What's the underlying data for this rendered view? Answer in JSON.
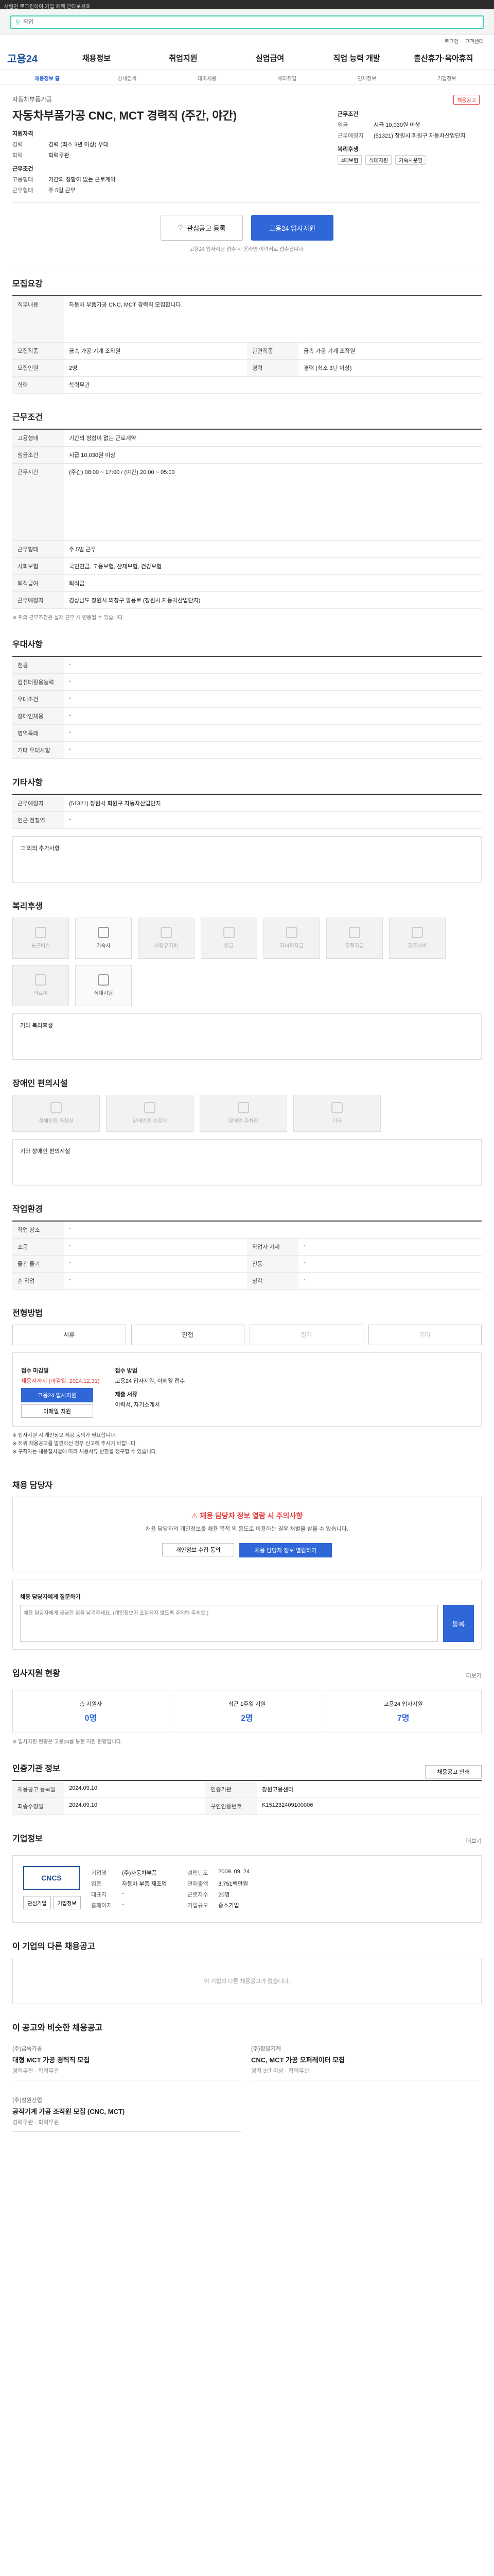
{
  "topbar": {
    "notice": "사람인 로그인하여 가입 혜택 받아보세요"
  },
  "search": {
    "value": "",
    "placeholder": "직업"
  },
  "util": {
    "login": "로그인",
    "help": "고객센터"
  },
  "gnb": {
    "logo": "고용24",
    "menus": [
      "채용정보",
      "취업지원",
      "실업급여",
      "직업 능력 개발",
      "출산휴가·육아휴직"
    ]
  },
  "subnav": [
    "채용정보 홈",
    "상세검색",
    "테마채용",
    "해외취업",
    "인재정보",
    "기업정보"
  ],
  "job": {
    "company": "자동차부품가공",
    "title": "자동차부품가공 CNC, MCT 경력직 (주간, 야간)",
    "badge": "채용공고",
    "left": {
      "section1": "지원자격",
      "rows": [
        {
          "k": "경력",
          "v": "경력 (최소 3년 이상) 우대"
        },
        {
          "k": "학력",
          "v": "학력무관"
        }
      ],
      "section2": "근무조건",
      "rows2": [
        {
          "k": "고용형태",
          "v": "기간의 정함이 없는 근로계약"
        },
        {
          "k": "근무형태",
          "v": "주 5일 근무"
        }
      ]
    },
    "right": {
      "section": "근무조건",
      "rows": [
        {
          "k": "임금",
          "v": "시급 10,030원 이상"
        },
        {
          "k": "근무예정지",
          "v": "(51321) 창원시 회원구 자동차산업단지"
        }
      ],
      "section2": "복리후생",
      "tags": [
        "4대보험",
        "식대지원",
        "기숙사운영"
      ]
    }
  },
  "actions": {
    "scrap": "관심공고 등록",
    "apply": "고용24 입사지원",
    "note": "고용24 입사지원 접수 시 온라인 이력서로 접수됩니다."
  },
  "recruit": {
    "title": "모집요강",
    "job_desc_label": "직무내용",
    "job_desc": "자동차 부품가공 CNC, MCT 경력직 모집합니다.",
    "rows": [
      {
        "k": "모집직종",
        "v": "금속 가공 기계 조작원",
        "k2": "관련직종",
        "v2": "금속 가공 기계 조작원"
      },
      {
        "k": "모집인원",
        "v": "2명",
        "k2": "경력",
        "v2": "경력 (최소 3년 이상)"
      },
      {
        "k": "학력",
        "v": "학력무관",
        "k2": "",
        "v2": ""
      }
    ]
  },
  "work": {
    "title": "근무조건",
    "rows": [
      {
        "k": "고용형태",
        "v": "기간의 정함이 없는 근로계약"
      },
      {
        "k": "임금조건",
        "v": "시급 10,030원 이상"
      },
      {
        "k": "근무시간",
        "v": "(주간) 08:00 ~ 17:00 / (야간) 20:00 ~ 05:00"
      },
      {
        "k": "근무형태",
        "v": "주 5일 근무"
      },
      {
        "k": "사회보험",
        "v": "국민연금, 고용보험, 산재보험, 건강보험"
      },
      {
        "k": "퇴직급여",
        "v": "퇴직금"
      },
      {
        "k": "근무예정지",
        "v": "경상남도 창원시 의창구 팔용로 (창원시 자동차산업단지)"
      }
    ],
    "note": "※ 위의 근무조건은 실제 근무 시 변동될 수 있습니다."
  },
  "pref": {
    "title": "우대사항",
    "rows": [
      {
        "k": "전공",
        "v": "-"
      },
      {
        "k": "컴퓨터활용능력",
        "v": "-"
      },
      {
        "k": "우대조건",
        "v": "-"
      },
      {
        "k": "장애인채용",
        "v": "-"
      },
      {
        "k": "병역특례",
        "v": "-"
      },
      {
        "k": "기타 우대사항",
        "v": "-"
      }
    ]
  },
  "etc": {
    "title": "기타사항",
    "rows": [
      {
        "k": "근무예정지",
        "v": "(51321) 창원시 회원구 자동차산업단지"
      },
      {
        "k": "인근 전철역",
        "v": "-"
      }
    ],
    "free_label": "그 외의 추가사항"
  },
  "welfare": {
    "title": "복리후생",
    "items": [
      {
        "label": "통근버스",
        "on": false,
        "icon": "bus-icon"
      },
      {
        "label": "기숙사",
        "on": true,
        "icon": "bed-icon"
      },
      {
        "label": "차량유지비",
        "on": false,
        "icon": "car-icon"
      },
      {
        "label": "연금",
        "on": false,
        "icon": "pension-icon"
      },
      {
        "label": "자녀학자금",
        "on": false,
        "icon": "graduation-icon"
      },
      {
        "label": "주택자금",
        "on": false,
        "icon": "house-icon"
      },
      {
        "label": "경조사비",
        "on": false,
        "icon": "gift-icon"
      },
      {
        "label": "의료비",
        "on": false,
        "icon": "medical-icon"
      },
      {
        "label": "식대지원",
        "on": true,
        "icon": "meal-icon"
      }
    ],
    "other_label": "기타 복리후생"
  },
  "disability": {
    "title": "장애인 편의시설",
    "items": [
      {
        "label": "장애인용 화장실",
        "icon": "toilet-icon"
      },
      {
        "label": "장애인용 승강기",
        "icon": "elevator-icon"
      },
      {
        "label": "장애인 주차장",
        "icon": "parking-icon"
      },
      {
        "label": "기타",
        "icon": "etc-icon"
      }
    ],
    "other_label": "기타 장애인 편의시설"
  },
  "envt": {
    "title": "작업환경",
    "rows": [
      {
        "k": "작업 장소",
        "v": "-",
        "k2": "",
        "v2": ""
      },
      {
        "k": "소음",
        "v": "-",
        "k2": "작업자 자세",
        "v2": "-"
      },
      {
        "k": "물건 들기",
        "v": "-",
        "k2": "진동",
        "v2": "-"
      },
      {
        "k": "손 작업",
        "v": "-",
        "k2": "청각",
        "v2": "-"
      }
    ]
  },
  "apply": {
    "title": "전형방법",
    "methods": [
      {
        "label": "서류",
        "on": true
      },
      {
        "label": "면접",
        "on": true
      },
      {
        "label": "필기",
        "on": false
      },
      {
        "label": "기타",
        "on": false
      }
    ],
    "period_label": "접수 마감일",
    "period": "채용시까지 (마감일: 2024.12.31)",
    "method_label": "접수 방법",
    "method": "고용24 입사지원, 이메일 접수",
    "docs_label": "제출 서류",
    "docs": "이력서, 자기소개서",
    "btn_apply": "고용24 입사지원",
    "btn_email": "이메일 지원",
    "bullets": [
      "※ 입사지원 시 개인정보 제공 동의가 필요합니다.",
      "※ 허위 채용공고를 발견하신 경우 신고해 주시기 바랍니다.",
      "※ 구직자는 채용절차법에 따라 채용서류 반환을 청구할 수 있습니다."
    ]
  },
  "contact": {
    "title": "채용 담당자",
    "warn_title": "채용 담당자 정보 열람 시 주의사항",
    "warn_desc": "채용 담당자의 개인정보를 채용 목적 외 용도로 이용하는 경우 처벌을 받을 수 있습니다.",
    "btn_personal": "개인정보 수집 동의",
    "btn_view": "채용 담당자 정보 열람하기",
    "q_title": "채용 담당자에게 질문하기",
    "q_placeholder": "채용 담당자에게 궁금한 점을 남겨주세요. (개인정보가 포함되지 않도록 주의해 주세요.)",
    "q_btn": "등록"
  },
  "status": {
    "title": "입사지원 현황",
    "more": "더보기",
    "items": [
      {
        "label": "총 지원자",
        "value": "0명"
      },
      {
        "label": "최근 1주일 지원",
        "value": "2명"
      },
      {
        "label": "고용24 입사지원",
        "value": "7명"
      }
    ],
    "note": "※ 입사지원 현황은 고용24를 통한 지원 현황입니다."
  },
  "reginfo": {
    "title": "인증기관 정보",
    "rows": [
      {
        "k": "채용공고 등록일",
        "v": "2024.09.10",
        "k2": "인증기관",
        "v2": "창원고용센터"
      },
      {
        "k": "최종수정일",
        "v": "2024.09.10",
        "k2": "구인인증번호",
        "v2": "K151232409100006"
      }
    ],
    "btn_print": "채용공고 인쇄"
  },
  "company": {
    "title": "기업정보",
    "more": "더보기",
    "logo": "CNCS",
    "col1": [
      {
        "k": "기업명",
        "v": "(주)자동차부품"
      },
      {
        "k": "업종",
        "v": "자동차 부품 제조업"
      },
      {
        "k": "대표자",
        "v": "-"
      },
      {
        "k": "홈페이지",
        "v": "-"
      }
    ],
    "col2": [
      {
        "k": "설립년도",
        "v": "2009. 09. 24"
      },
      {
        "k": "연매출액",
        "v": "3,751백만원"
      },
      {
        "k": "근로자수",
        "v": "20명"
      },
      {
        "k": "기업규모",
        "v": "중소기업"
      }
    ],
    "btns": [
      "관심기업",
      "기업정보"
    ]
  },
  "other_jobs": {
    "title": "이 기업의 다른 채용공고",
    "empty": "이 기업의 다른 채용공고가 없습니다."
  },
  "recommend": {
    "title": "이 공고와 비슷한 채용공고",
    "cards": [
      {
        "company": "(주)금속가공",
        "title": "대형 MCT 가공 경력직 모집",
        "meta": "경력무관 · 학력무관"
      },
      {
        "company": "(주)정밀기계",
        "title": "CNC, MCT 가공 오퍼레이터 모집",
        "meta": "경력 3년 이상 · 학력무관"
      },
      {
        "company": "(주)창원산업",
        "title": "공작기계 가공 조작원 모집 (CNC, MCT)",
        "meta": "경력무관 · 학력무관"
      }
    ]
  }
}
